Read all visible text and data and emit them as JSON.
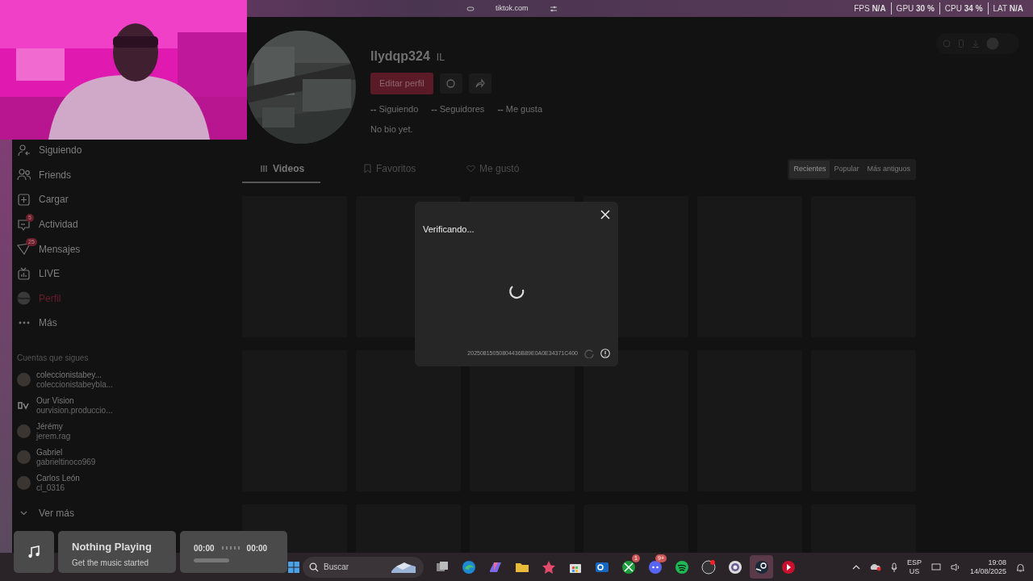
{
  "browser": {
    "address": "tiktok.com"
  },
  "stats": [
    {
      "label": "FPS",
      "value": "N/A"
    },
    {
      "label": "GPU",
      "value": "30 %"
    },
    {
      "label": "CPU",
      "value": "34 %"
    },
    {
      "label": "LAT",
      "value": "N/A"
    }
  ],
  "sidebar": {
    "items": [
      {
        "label": "Siguiendo",
        "kind": "following",
        "selected": false
      },
      {
        "label": "Friends",
        "kind": "friends",
        "selected": false
      },
      {
        "label": "Cargar",
        "kind": "upload",
        "selected": false
      },
      {
        "label": "Actividad",
        "kind": "activity",
        "badge": "5",
        "selected": false
      },
      {
        "label": "Mensajes",
        "kind": "messages",
        "badge": "25",
        "selected": false
      },
      {
        "label": "LIVE",
        "kind": "live",
        "selected": false
      },
      {
        "label": "Perfil",
        "kind": "profile",
        "selected": true
      },
      {
        "label": "Más",
        "kind": "more",
        "selected": false
      }
    ],
    "following_title": "Cuentas que sigues",
    "accounts": [
      {
        "name": "coleccionistabey...",
        "handle": "coleccionistabeybla...",
        "kind": "avatar"
      },
      {
        "name": "Our Vision",
        "handle": "ourvision.produccio...",
        "kind": "logo"
      },
      {
        "name": "Jérémy",
        "handle": "jerem.rag",
        "kind": "avatar"
      },
      {
        "name": "Gabriel",
        "handle": "gabrieltinoco969",
        "kind": "avatar"
      },
      {
        "name": "Carlos León",
        "handle": "cl_0316",
        "kind": "avatar"
      }
    ],
    "see_more": "Ver más"
  },
  "profile": {
    "username": "llydqp324",
    "tag": "IL",
    "edit_button": "Editar perfil",
    "stats": [
      {
        "count": "--",
        "label": "Siguiendo"
      },
      {
        "count": "--",
        "label": "Seguidores"
      },
      {
        "count": "--",
        "label": "Me gusta"
      }
    ],
    "bio": "No bio yet."
  },
  "tabs": [
    {
      "label": "Videos",
      "kind": "grid",
      "selected": true
    },
    {
      "label": "Favoritos",
      "kind": "bookmark",
      "selected": false
    },
    {
      "label": "Me gustó",
      "kind": "heart",
      "selected": false
    }
  ],
  "sort": [
    {
      "label": "Recientes",
      "selected": true
    },
    {
      "label": "Popular",
      "selected": false
    },
    {
      "label": "Más antiguos",
      "selected": false
    }
  ],
  "dialog": {
    "title": "Verificando...",
    "code": "20250815050804436B89E0A0E34371C400"
  },
  "music": {
    "title": "Nothing Playing",
    "subtitle": "Get the music started",
    "elapsed": "00:00",
    "total": "00:00"
  },
  "taskbar": {
    "search_placeholder": "Buscar",
    "apps": [
      {
        "kind": "task-view",
        "selected": false
      },
      {
        "kind": "browser",
        "selected": false
      },
      {
        "kind": "copilot",
        "selected": false
      },
      {
        "kind": "folder",
        "selected": false
      },
      {
        "kind": "star-app",
        "selected": false
      },
      {
        "kind": "store",
        "selected": false
      },
      {
        "kind": "mail",
        "selected": false
      },
      {
        "kind": "green-circle",
        "badge": "1",
        "selected": false
      },
      {
        "kind": "chat",
        "badge": "9+",
        "selected": false
      },
      {
        "kind": "music",
        "selected": false
      },
      {
        "kind": "recorder",
        "selected": false
      },
      {
        "kind": "ring",
        "selected": false
      },
      {
        "kind": "game",
        "selected": true
      },
      {
        "kind": "play",
        "selected": false
      }
    ],
    "language": "ESP",
    "layout": "US",
    "time": "19:08",
    "date": "14/08/2025"
  }
}
